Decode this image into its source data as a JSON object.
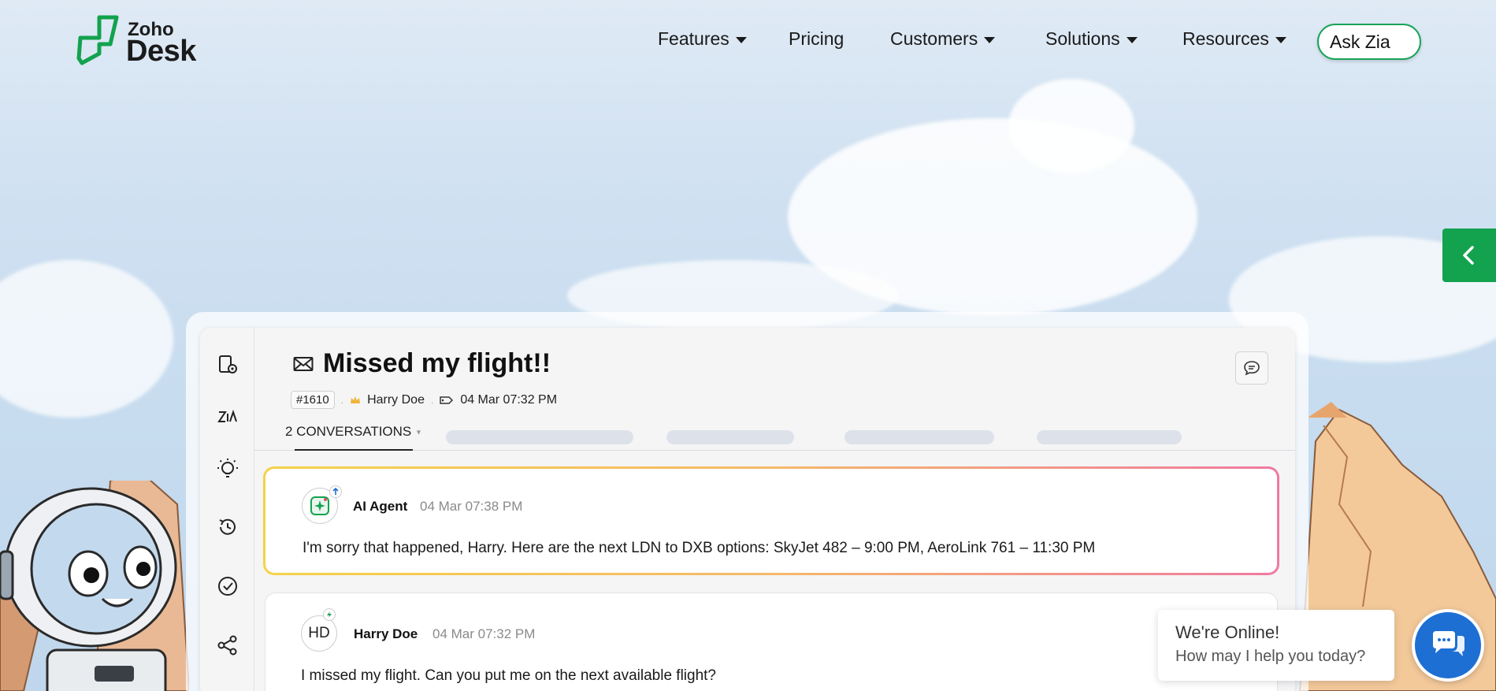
{
  "header": {
    "logo_top": "Zoho",
    "logo_bottom": "Desk",
    "nav": [
      {
        "label": "Features",
        "has_caret": true
      },
      {
        "label": "Pricing",
        "has_caret": false
      },
      {
        "label": "Customers",
        "has_caret": true
      },
      {
        "label": "Solutions",
        "has_caret": true
      },
      {
        "label": "Resources",
        "has_caret": true
      }
    ],
    "cta_label": "Ask Zia"
  },
  "ticket": {
    "title": "Missed my flight!!",
    "id": "#1610",
    "customer": "Harry Doe",
    "created": "04 Mar 07:32 PM",
    "tab_label": "2 CONVERSATIONS"
  },
  "conversations": [
    {
      "sender": "AI Agent",
      "time": "04 Mar 07:38 PM",
      "avatar_icon": "ai-sparkle-icon",
      "body": "I'm sorry that happened, Harry. Here are the next LDN to DXB options: SkyJet 482 – 9:00 PM,  AeroLink 761 – 11:30 PM"
    },
    {
      "sender": "Harry Doe",
      "initials": "HD",
      "time": "04 Mar 07:32 PM",
      "body": "I missed my flight. Can you put me on the next available flight?"
    }
  ],
  "chat_widget": {
    "line1": "We're Online!",
    "line2": "How may I help you today?"
  },
  "colors": {
    "brand_green": "#13a24e",
    "chat_blue": "#1d6fd3",
    "ai_border_start": "#f5d248",
    "ai_border_end": "#f07aa0"
  }
}
